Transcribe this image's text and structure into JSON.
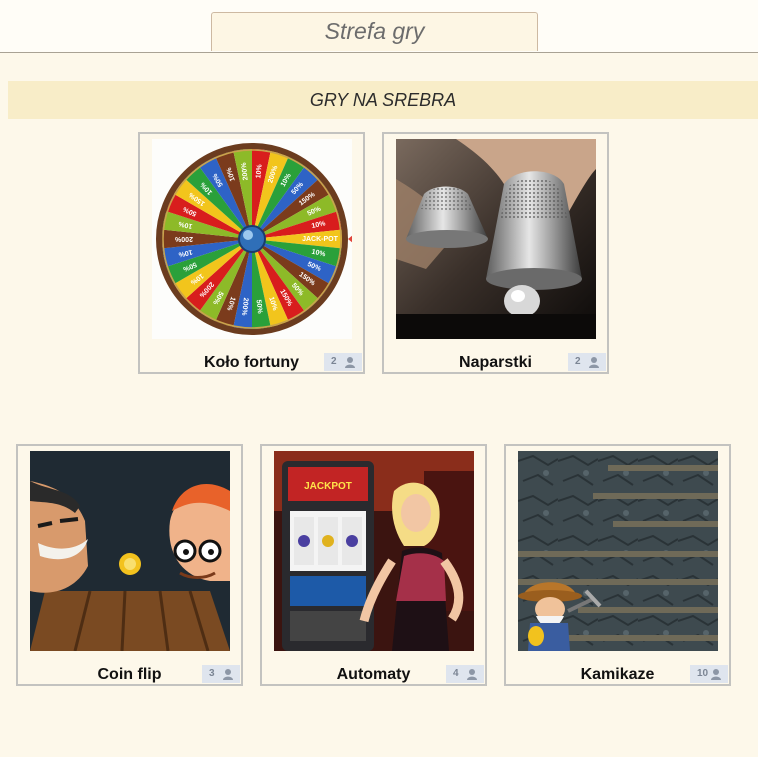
{
  "header": {
    "tab_title": "Strefa gry"
  },
  "section": {
    "title": "GRY NA SREBRA"
  },
  "games": [
    {
      "title": "Koło fortuny",
      "players": "2"
    },
    {
      "title": "Naparstki",
      "players": "2"
    },
    {
      "title": "Coin flip",
      "players": "3"
    },
    {
      "title": "Automaty",
      "players": "4"
    },
    {
      "title": "Kamikaze",
      "players": "10"
    }
  ],
  "wheel": {
    "labels": [
      "10%",
      "200%",
      "10%",
      "50%",
      "150%",
      "50%",
      "10%",
      "JACK-POT",
      "10%",
      "50%",
      "150%",
      "50%",
      "150%",
      "10%",
      "50%",
      "200%",
      "10%",
      "50%",
      "200%",
      "10%",
      "50%",
      "10%",
      "200%",
      "10%",
      "50%",
      "150%",
      "10%",
      "50%",
      "10%",
      "200%"
    ],
    "colors": [
      "#d81d1d",
      "#f2c51c",
      "#2aa03a",
      "#2e63c6",
      "#7b3b1c",
      "#8dba28"
    ]
  },
  "slot": {
    "jackpot_label": "JACKPOT"
  }
}
